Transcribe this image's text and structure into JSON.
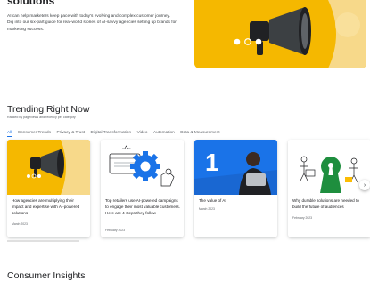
{
  "hero": {
    "title": "solutions",
    "description": "AI can help marketers keep pace with today's evolving and complex customer journey. Dig into our six-part guide for real-world stories of AI-savvy agencies setting up brands for marketing success."
  },
  "trending": {
    "title": "Trending Right Now",
    "subtitle": "Ranked by pageviews and recency per category",
    "tabs": [
      {
        "label": "All",
        "active": true
      },
      {
        "label": "Consumer Trends",
        "active": false
      },
      {
        "label": "Privacy & Trust",
        "active": false
      },
      {
        "label": "Digital Transformation",
        "active": false
      },
      {
        "label": "Video",
        "active": false
      },
      {
        "label": "Automation",
        "active": false
      },
      {
        "label": "Data & Measurement",
        "active": false
      }
    ],
    "cards": [
      {
        "title": "How agencies are multiplying their impact and expertise with AI-powered solutions",
        "date": "March 2023"
      },
      {
        "title": "Top retailers use AI-powered campaigns to engage their most valuable customers. Here are 4 steps they follow",
        "date": "February 2023"
      },
      {
        "title": "The value of AI",
        "date": "March 2023"
      },
      {
        "title": "Why durable solutions are needed to build the future of audiences",
        "date": "February 2023"
      }
    ],
    "next_icon": "›"
  },
  "consumer": {
    "title": "Consumer Insights"
  },
  "colors": {
    "accent": "#1a73e8",
    "yellow": "#f5b800",
    "blue": "#1a73e8"
  },
  "icons": [
    "megaphone-icon",
    "gear-icon",
    "chevron-right-icon"
  ]
}
